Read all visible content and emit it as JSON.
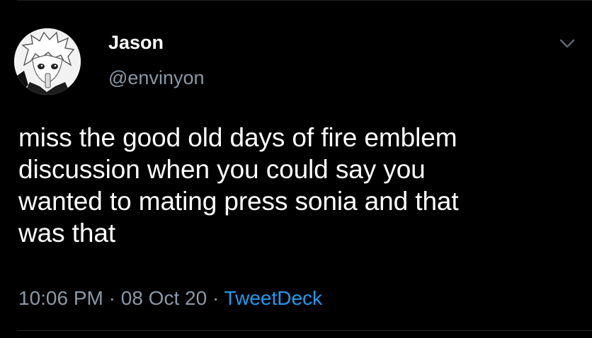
{
  "author": {
    "display_name": "Jason",
    "handle": "@envinyon"
  },
  "tweet": {
    "text": "miss the good old days of fire emblem\ndiscussion when you could say you\nwanted to mating press sonia and that\nwas that",
    "time": "10:06 PM",
    "separator": "·",
    "date": "08 Oct 20",
    "source": "TweetDeck"
  },
  "icons": {
    "avatar": "avatar-anime-boy",
    "more": "chevron-down-icon"
  },
  "colors": {
    "background": "#000000",
    "text": "#ffffff",
    "secondary": "#8b98a5",
    "link": "#1d9bf0"
  }
}
